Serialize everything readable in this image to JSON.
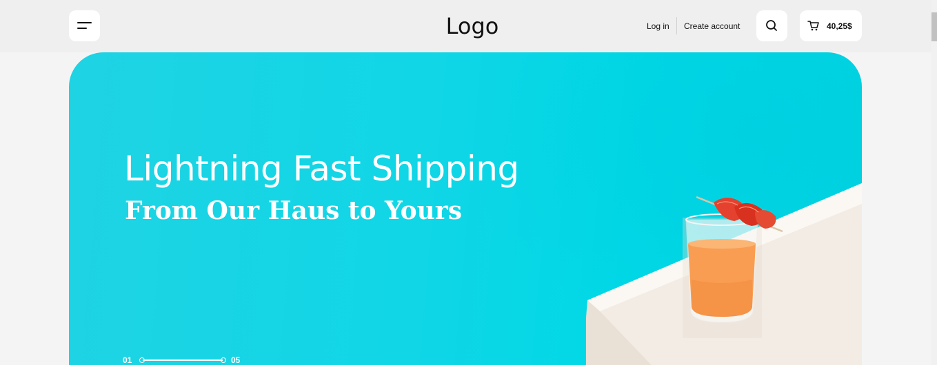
{
  "header": {
    "logo": "Logo",
    "login_label": "Log in",
    "create_account_label": "Create account",
    "cart_total": "40,25$",
    "menu_icon": "hamburger-icon",
    "search_icon": "search-icon",
    "cart_icon": "cart-icon"
  },
  "hero": {
    "title": "Lightning Fast Shipping",
    "subtitle": "From Our Haus to Yours",
    "accent_color": "#00d8e6",
    "slider": {
      "current": "01",
      "total": "05"
    }
  }
}
